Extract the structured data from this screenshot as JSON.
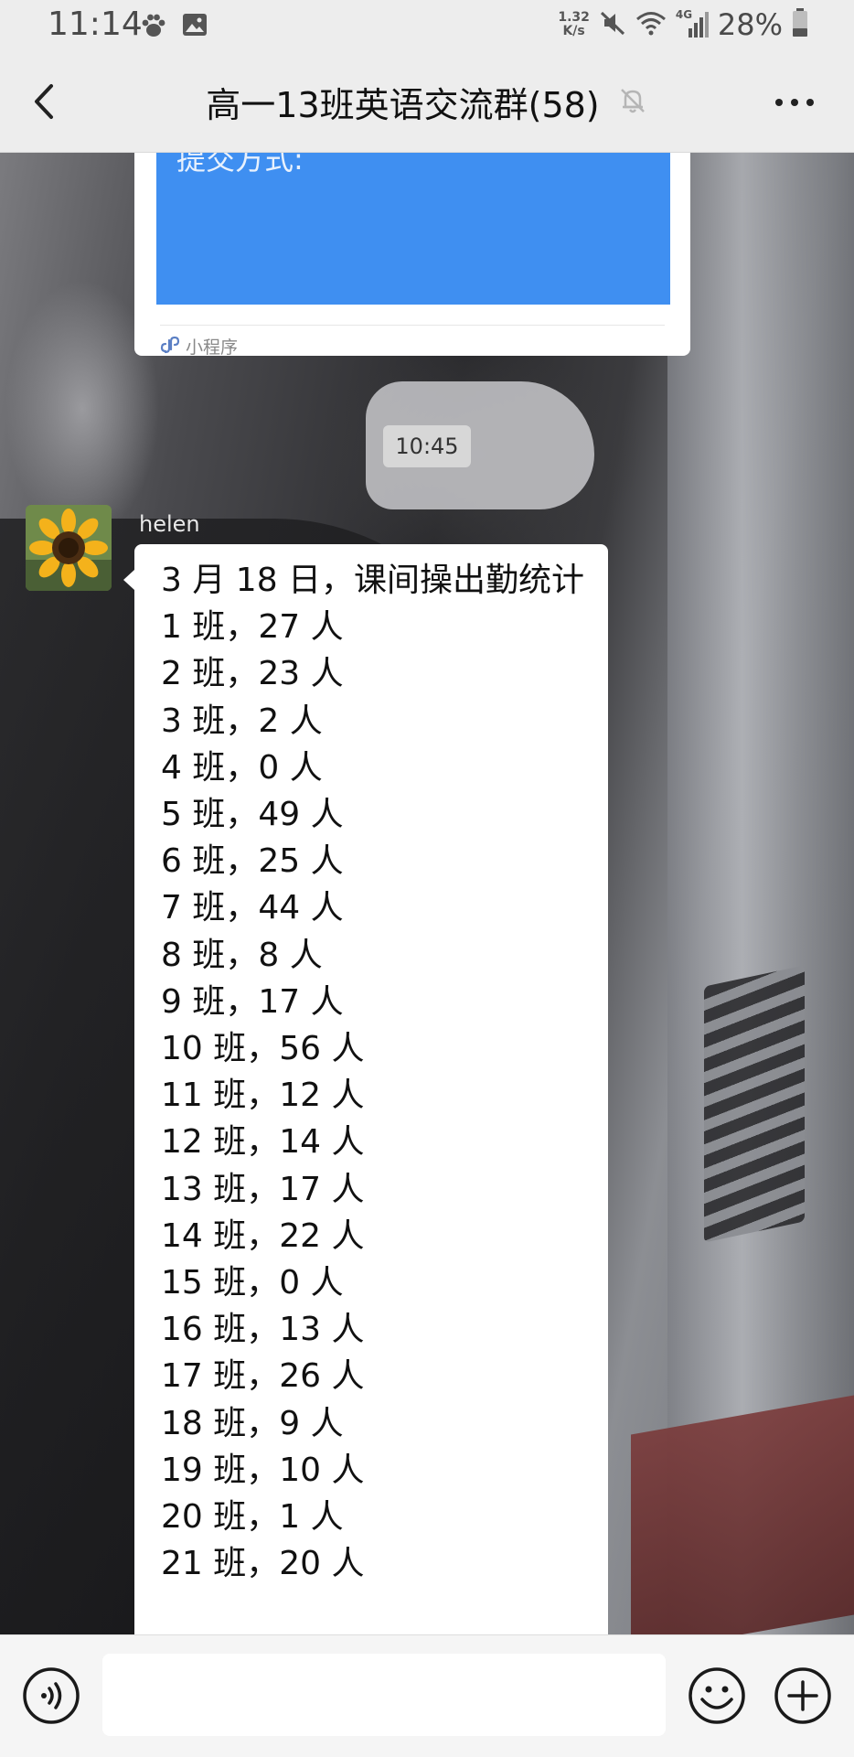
{
  "status_bar": {
    "time": "11:14",
    "net_speed_value": "1.32",
    "net_speed_unit": "K/s",
    "network": "4G",
    "battery": "28%",
    "icons": [
      "paw-icon",
      "image-icon",
      "mute-icon",
      "wifi-icon",
      "signal-icon",
      "battery-icon"
    ]
  },
  "header": {
    "title": "高一13班英语交流群(58)",
    "icons": [
      "back-icon",
      "bell-off-icon",
      "more-icon"
    ]
  },
  "chat": {
    "mini_program": {
      "image_text": "提交方式:",
      "label": "小程序",
      "accent": "#3f8ff1"
    },
    "timestamp": "10:45",
    "message": {
      "sender": "helen",
      "lines": [
        "3 月 18 日，课间操出勤统计",
        "1 班，27 人",
        "2 班，23 人",
        "3 班，2 人",
        "4 班，0 人",
        "5 班，49 人",
        "6 班，25 人",
        "7 班，44 人",
        "8 班，8 人",
        "9 班，17 人",
        "10 班，56 人",
        "11 班，12 人",
        "12 班，14 人",
        "13 班，17 人",
        "14 班，22 人",
        "15 班，0 人",
        "16 班，13 人",
        "17 班，26 人",
        "18 班，9 人",
        "19 班，10 人",
        "20 班，1 人",
        "21 班，20 人"
      ]
    }
  },
  "input_bar": {
    "value": "",
    "icons": [
      "voice-icon",
      "emoji-icon",
      "plus-icon"
    ]
  }
}
